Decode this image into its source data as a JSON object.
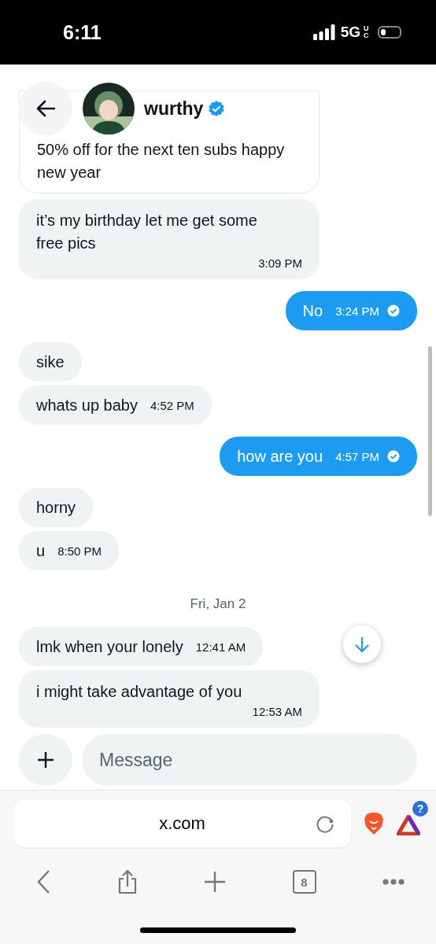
{
  "status_bar": {
    "time": "6:11",
    "network": "5G",
    "network_sub": "UC"
  },
  "header": {
    "name": "wurthy",
    "verified": true
  },
  "messages": [
    {
      "kind": "received",
      "text": "50% off for the next ten subs happy new year",
      "framed": true
    },
    {
      "kind": "received",
      "text": "it’s my birthday let me get some free pics",
      "time": "3:09 PM",
      "time_below": true
    },
    {
      "kind": "sent",
      "text": "No",
      "time": "3:24 PM",
      "read": true
    },
    {
      "kind": "received",
      "text": "sike"
    },
    {
      "kind": "received",
      "text": "whats up baby",
      "time": "4:52 PM"
    },
    {
      "kind": "sent",
      "text": "how are you",
      "time": "4:57 PM",
      "read": true
    },
    {
      "kind": "received",
      "text": "horny"
    },
    {
      "kind": "received",
      "text": "u",
      "time": "8:50 PM"
    },
    {
      "kind": "date",
      "text": "Fri, Jan 2"
    },
    {
      "kind": "received",
      "text": "lmk when your lonely",
      "time": "12:41 AM"
    },
    {
      "kind": "received",
      "text": "i might take advantage of you",
      "time": "12:53 AM",
      "time_below": true
    }
  ],
  "composer": {
    "placeholder": "Message"
  },
  "browser": {
    "url": "x.com",
    "rewards_badge": "?",
    "tab_count": "8"
  }
}
